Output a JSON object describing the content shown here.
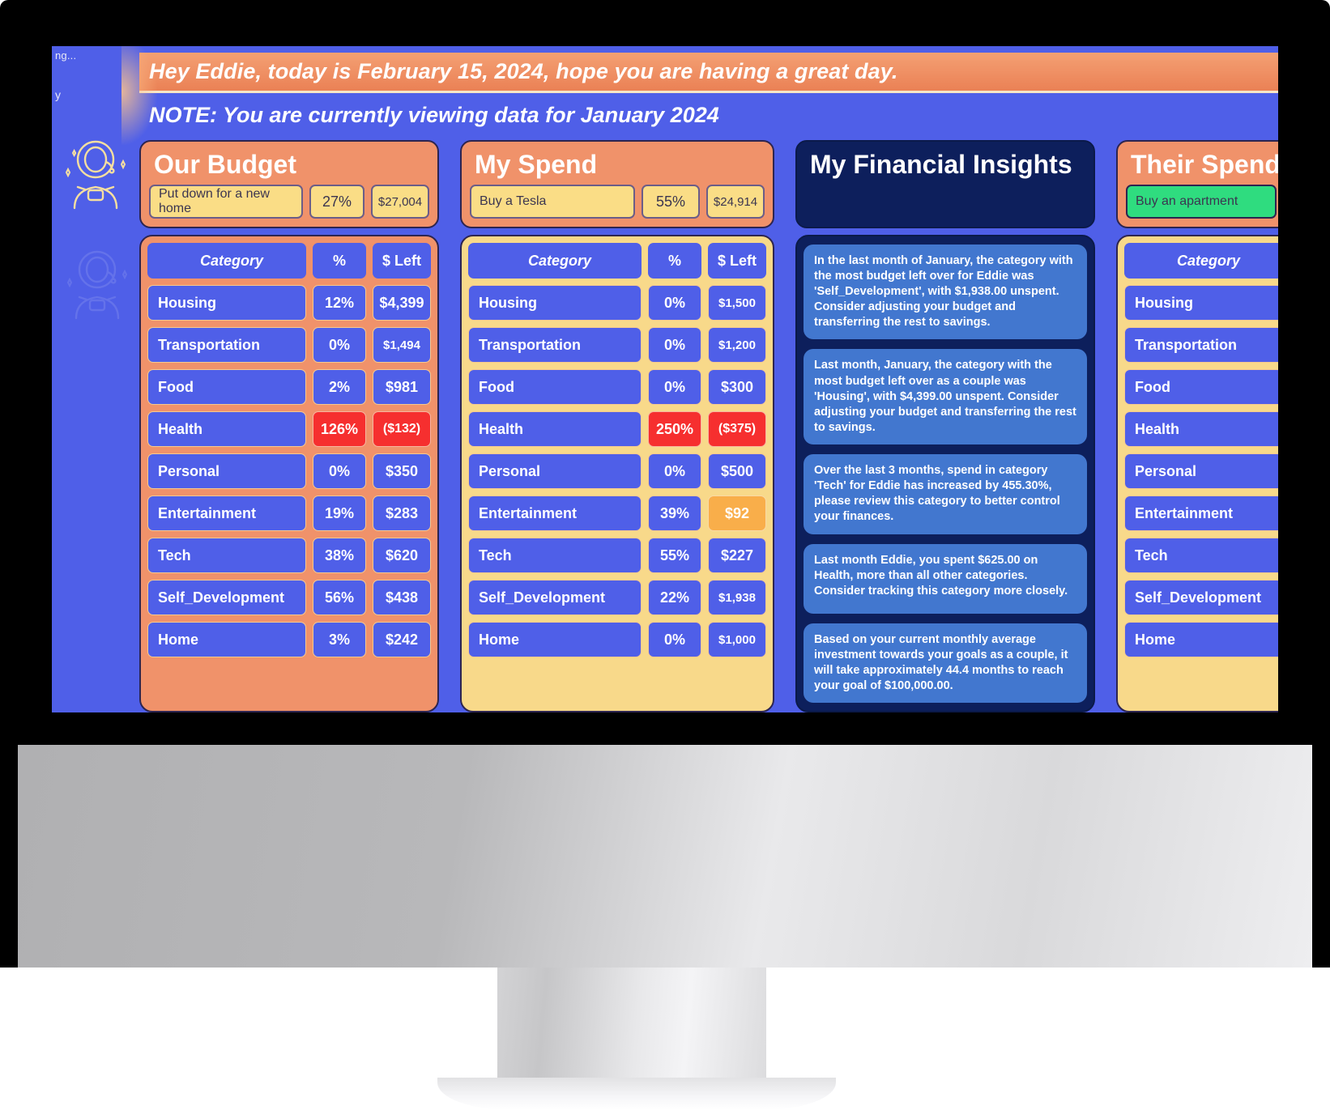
{
  "banners": {
    "greeting": "Hey Eddie, today is February 15, 2024, hope you are having a great day.",
    "note": "NOTE: You are currently viewing data for January 2024"
  },
  "sidebar": {
    "clipped_top": "ng...",
    "clipped_second": "y",
    "icons": [
      "astronaut-icon",
      "astronaut-icon"
    ]
  },
  "table_headers": {
    "category": "Category",
    "percent": "%",
    "left": "$ Left"
  },
  "cards": [
    {
      "title": "Our Budget",
      "goal_name": "Put down for a new home",
      "goal_pct": "27%",
      "goal_amt": "$27,004",
      "rows": [
        {
          "category": "Housing",
          "pct": "12%",
          "left": "$4,399",
          "state": "normal"
        },
        {
          "category": "Transportation",
          "pct": "0%",
          "left": "$1,494",
          "state": "normal"
        },
        {
          "category": "Food",
          "pct": "2%",
          "left": "$981",
          "state": "normal"
        },
        {
          "category": "Health",
          "pct": "126%",
          "left": "($132)",
          "state": "danger"
        },
        {
          "category": "Personal",
          "pct": "0%",
          "left": "$350",
          "state": "normal"
        },
        {
          "category": "Entertainment",
          "pct": "19%",
          "left": "$283",
          "state": "normal"
        },
        {
          "category": "Tech",
          "pct": "38%",
          "left": "$620",
          "state": "normal"
        },
        {
          "category": "Self_Development",
          "pct": "56%",
          "left": "$438",
          "state": "normal"
        },
        {
          "category": "Home",
          "pct": "3%",
          "left": "$242",
          "state": "normal"
        }
      ]
    },
    {
      "title": "My Spend",
      "goal_name": "Buy a Tesla",
      "goal_pct": "55%",
      "goal_amt": "$24,914",
      "rows": [
        {
          "category": "Housing",
          "pct": "0%",
          "left": "$1,500",
          "state": "normal"
        },
        {
          "category": "Transportation",
          "pct": "0%",
          "left": "$1,200",
          "state": "normal"
        },
        {
          "category": "Food",
          "pct": "0%",
          "left": "$300",
          "state": "normal"
        },
        {
          "category": "Health",
          "pct": "250%",
          "left": "($375)",
          "state": "danger"
        },
        {
          "category": "Personal",
          "pct": "0%",
          "left": "$500",
          "state": "normal"
        },
        {
          "category": "Entertainment",
          "pct": "39%",
          "left": "$92",
          "state": "warn-left"
        },
        {
          "category": "Tech",
          "pct": "55%",
          "left": "$227",
          "state": "normal"
        },
        {
          "category": "Self_Development",
          "pct": "22%",
          "left": "$1,938",
          "state": "normal"
        },
        {
          "category": "Home",
          "pct": "0%",
          "left": "$1,000",
          "state": "normal"
        }
      ]
    },
    {
      "title": "Their Spend",
      "goal_name": "Buy an apartment",
      "goal_pct": "",
      "goal_amt": "",
      "rows": [
        {
          "category": "Housing",
          "pct": "",
          "left": "",
          "state": "normal"
        },
        {
          "category": "Transportation",
          "pct": "",
          "left": "",
          "state": "normal"
        },
        {
          "category": "Food",
          "pct": "",
          "left": "",
          "state": "normal"
        },
        {
          "category": "Health",
          "pct": "",
          "left": "",
          "state": "normal"
        },
        {
          "category": "Personal",
          "pct": "",
          "left": "",
          "state": "normal"
        },
        {
          "category": "Entertainment",
          "pct": "",
          "left": "",
          "state": "normal"
        },
        {
          "category": "Tech",
          "pct": "",
          "left": "",
          "state": "normal"
        },
        {
          "category": "Self_Development",
          "pct": "",
          "left": "",
          "state": "normal"
        },
        {
          "category": "Home",
          "pct": "",
          "left": "",
          "state": "normal"
        }
      ]
    }
  ],
  "insights": {
    "title": "My Financial Insights",
    "items": [
      "In the last month of January, the category with the most budget left over for Eddie was 'Self_Development', with $1,938.00 unspent. Consider adjusting your budget and transferring the rest to savings.",
      "Last month, January, the category with the most budget left over as a couple was 'Housing', with $4,399.00 unspent. Consider adjusting your budget and transferring the rest to savings.",
      "Over the last 3 months, spend in category 'Tech' for Eddie has increased by 455.30%, please review this category to better control your finances.",
      "Last month Eddie, you spent $625.00 on Health, more than all other categories. Consider tracking this category more closely.",
      "Based on your current monthly average investment towards your goals as a couple, it will take approximately 44.4 months to reach your goal of $100,000.00."
    ]
  },
  "colors": {
    "background_blue": "#4f5fe8",
    "card_orange": "#f0926a",
    "card_yellow": "#f8d98a",
    "insights_navy": "#0d1f5c",
    "insight_card": "#4277cf",
    "danger_red": "#f62f2f",
    "warn_orange": "#f9ae4a",
    "goal_yellow": "#fadd86",
    "goal_green": "#2fdc7f",
    "header_dark": "#2b2b2b"
  }
}
